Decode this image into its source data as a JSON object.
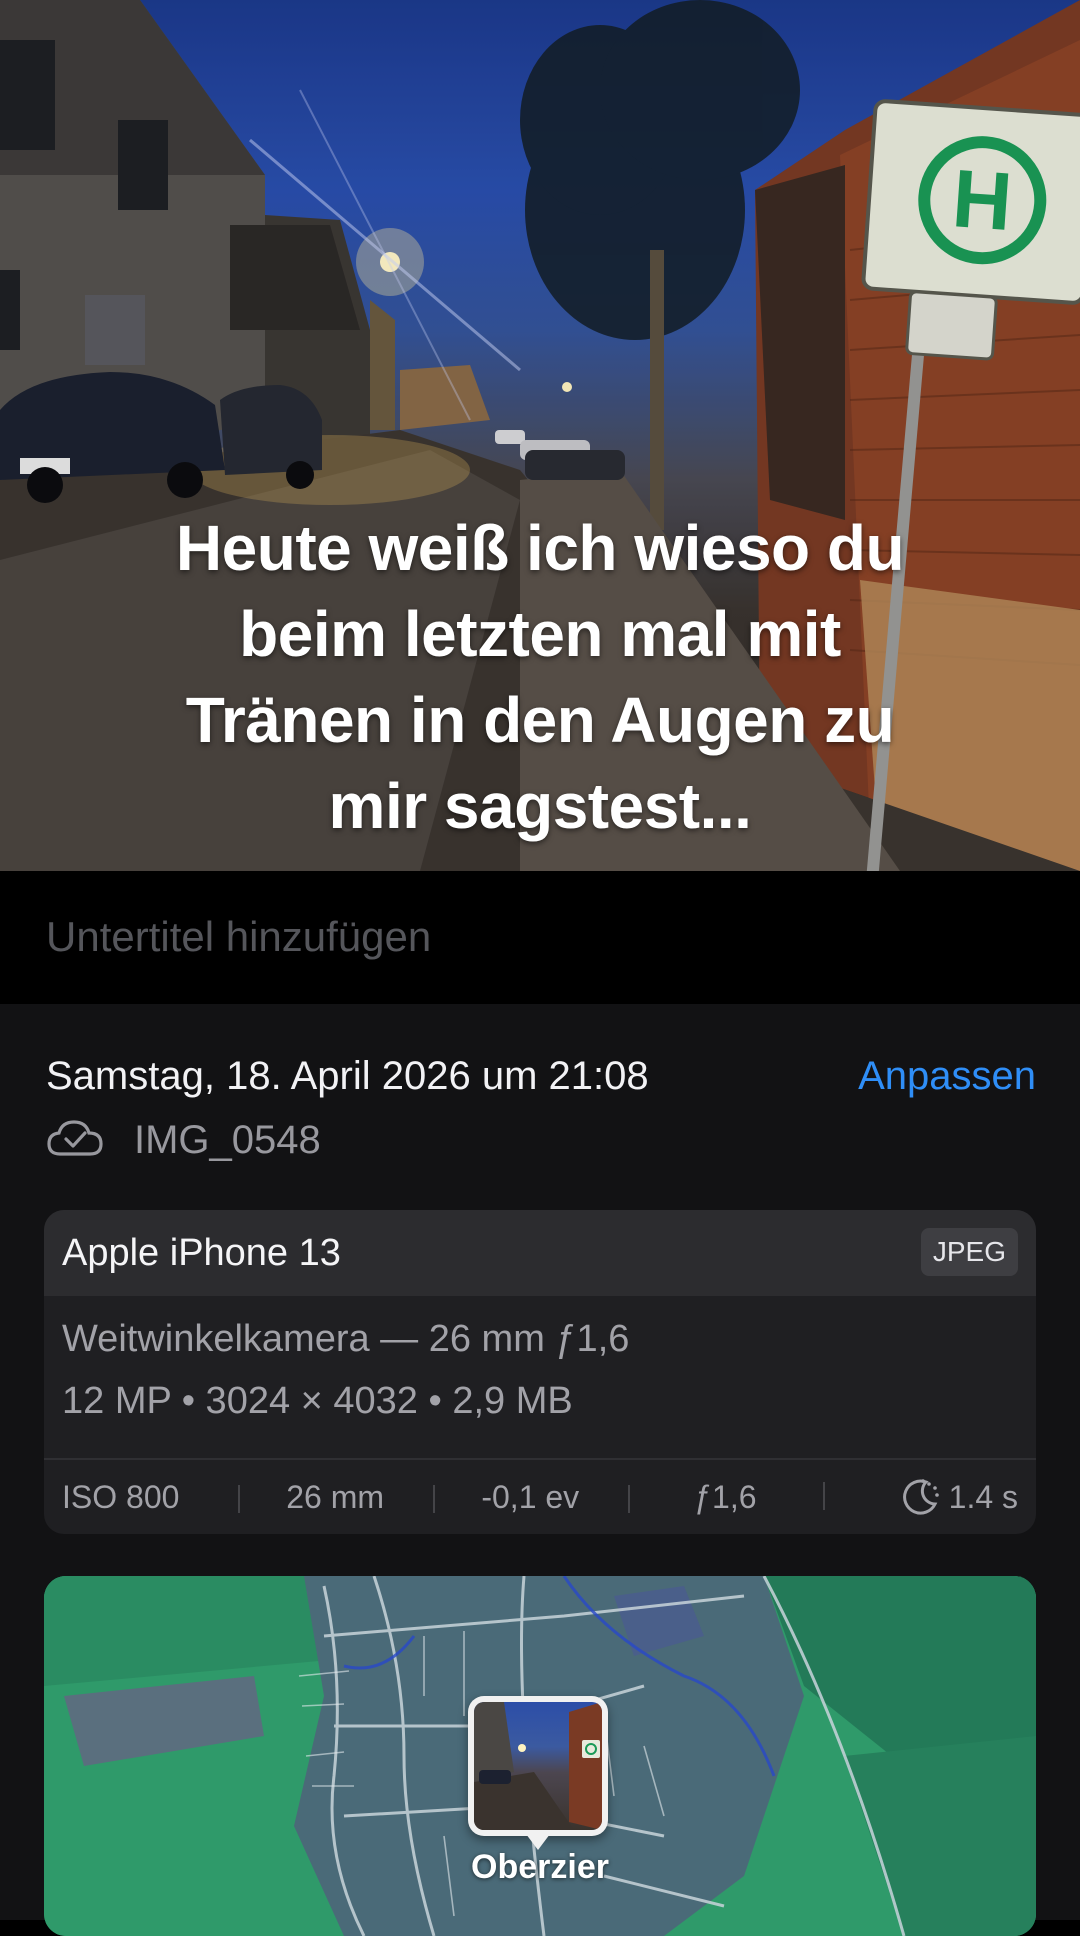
{
  "photo": {
    "caption_lines": [
      "Heute weiß ich wieso du",
      "beim letzten mal mit",
      "Tränen in den Augen zu",
      "mir sagstest..."
    ],
    "sign_letter": "H"
  },
  "subtitle": {
    "placeholder": "Untertitel hinzufügen"
  },
  "info": {
    "datetime": "Samstag, 18. April 2026 um 21:08",
    "adjust_label": "Anpassen",
    "filename": "IMG_0548",
    "cloud_icon": "icloud-synced-icon"
  },
  "camera": {
    "device": "Apple iPhone 13",
    "format": "JPEG",
    "lens": "Weitwinkelkamera — 26 mm ƒ1,6",
    "specs": "12 MP  •  3024 × 4032  •  2,9 MB",
    "exif": {
      "iso": "ISO 800",
      "focal": "26 mm",
      "ev": "-0,1 ev",
      "aperture": "ƒ1,6",
      "shutter": "1.4 s",
      "shutter_icon": "night-mode-icon"
    }
  },
  "map": {
    "place": "Oberzier"
  },
  "colors": {
    "accent": "#2f8ef7",
    "panel_bg": "#121214",
    "card_bg": "#1f1f22",
    "map_green": "#2f9a6a"
  }
}
